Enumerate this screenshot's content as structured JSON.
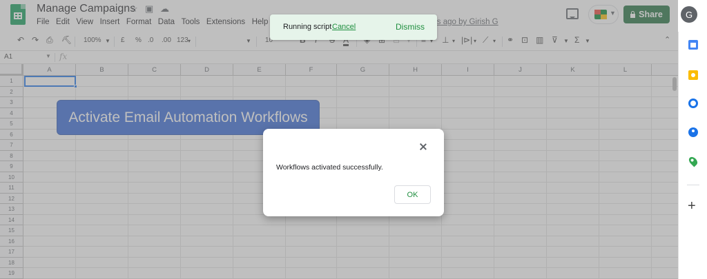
{
  "header": {
    "title": "Manage Campaigns",
    "menu": [
      "File",
      "Edit",
      "View",
      "Insert",
      "Format",
      "Data",
      "Tools",
      "Extensions",
      "Help"
    ],
    "last_edit": "nds ago by Girish G",
    "share_label": "Share",
    "avatar_initial": "G",
    "icons": [
      "star-icon",
      "move-folder-icon",
      "cloud-status-icon",
      "comment-icon",
      "meet-icon"
    ]
  },
  "toolbar": {
    "zoom": "100%",
    "currency": "£",
    "percent": "%",
    "dec_decrease": ".0",
    "dec_increase": ".00",
    "format_more": "123",
    "font_size": "10",
    "bold": "B",
    "italic": "I",
    "strike": "S",
    "text_color": "A",
    "functions": "Σ",
    "accent_color": "#1e8e3e"
  },
  "formula_bar": {
    "name_box": "A1",
    "fx": "fx"
  },
  "grid": {
    "columns": [
      "A",
      "B",
      "C",
      "D",
      "E",
      "F",
      "G",
      "H",
      "I",
      "J",
      "K",
      "L"
    ],
    "rows": [
      "1",
      "2",
      "3",
      "4",
      "5",
      "6",
      "7",
      "8",
      "9",
      "10",
      "11",
      "12",
      "13",
      "14",
      "15",
      "16",
      "17",
      "18",
      "19"
    ],
    "selected_cell": "A1"
  },
  "sheet_button": {
    "label": "Activate Email Automation Workflows",
    "color": "#3367d6"
  },
  "toast": {
    "text": "Running script",
    "cancel": "Cancel",
    "dismiss": "Dismiss"
  },
  "dialog": {
    "message": "Workflows activated successfully.",
    "ok_label": "OK"
  },
  "side_panel": {
    "items": [
      "calendar-icon",
      "keep-icon",
      "tasks-icon",
      "contacts-icon",
      "maps-icon"
    ],
    "add": "+"
  }
}
